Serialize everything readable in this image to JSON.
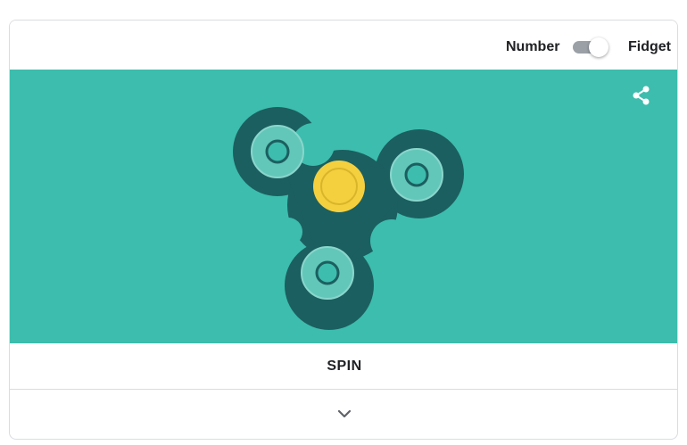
{
  "header": {
    "mode_left_label": "Number",
    "mode_right_label": "Fidget",
    "toggle_state": "Fidget"
  },
  "stage": {
    "background_color": "#3dbdad",
    "share_icon": "share-icon",
    "spinner": {
      "body_color": "#1c5f60",
      "bearing_color": "#f4d03f",
      "weight_color": "#62c7b9"
    }
  },
  "spin_button": {
    "label": "SPIN"
  },
  "expand": {
    "icon": "chevron-down-icon"
  }
}
